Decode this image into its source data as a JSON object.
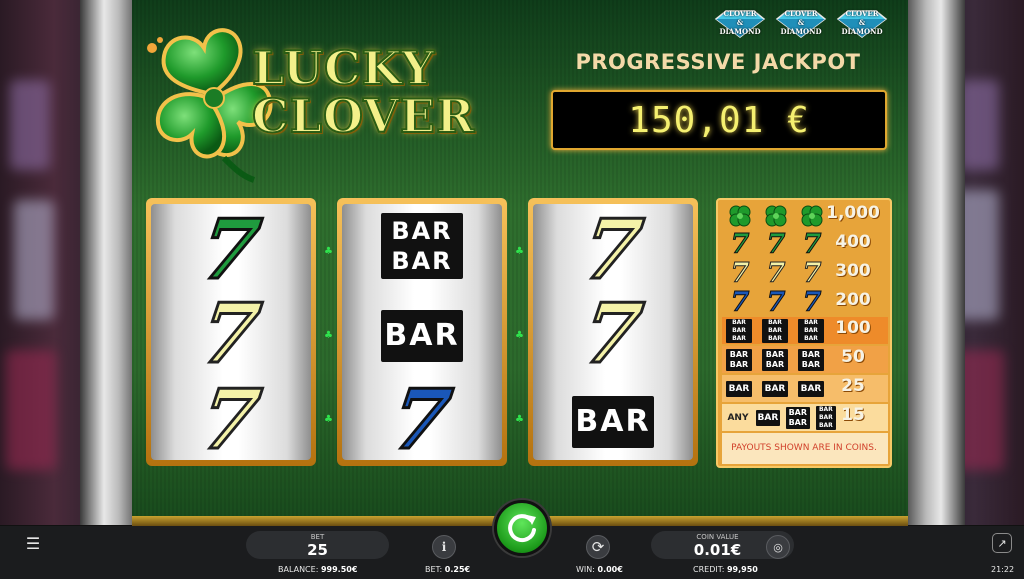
{
  "game": {
    "logo_line1": "LUCKY",
    "logo_line2": "CLOVER",
    "badges": [
      {
        "line1": "CLOVER",
        "line2": "&",
        "line3": "DIAMOND"
      },
      {
        "line1": "CLOVER",
        "line2": "&",
        "line3": "DIAMOND"
      },
      {
        "line1": "CLOVER",
        "line2": "&",
        "line3": "DIAMOND"
      }
    ]
  },
  "jackpot": {
    "title": "PROGRESSIVE JACKPOT",
    "value": "150,01 €"
  },
  "reels": [
    [
      "green-seven",
      "cream-seven",
      "cream-seven"
    ],
    [
      "double-bar",
      "single-bar",
      "blue-seven"
    ],
    [
      "cream-seven",
      "cream-seven",
      "single-bar"
    ]
  ],
  "symbols": {
    "seven": "7",
    "bar": "BAR",
    "any": "ANY"
  },
  "paytable": {
    "rows": [
      {
        "combo": "clover x3",
        "payout": "1,000"
      },
      {
        "combo": "green-seven x3",
        "payout": "400"
      },
      {
        "combo": "cream-seven x3",
        "payout": "300"
      },
      {
        "combo": "blue-seven x3",
        "payout": "200"
      },
      {
        "combo": "triple-bar x3",
        "payout": "100"
      },
      {
        "combo": "double-bar x3",
        "payout": "50"
      },
      {
        "combo": "single-bar x3",
        "payout": "25"
      },
      {
        "combo": "any bar x3",
        "payout": "15"
      }
    ],
    "note": "PAYOUTS SHOWN ARE IN COINS."
  },
  "colors": {
    "green_seven": "#1f9b3e",
    "cream_seven": "#f4f2a8",
    "blue_seven": "#1a57b8",
    "paytable_bg": "#e7a43a",
    "jackpot_digits": "#f5f070"
  },
  "controls": {
    "bet_label": "BET",
    "bet_value": "25",
    "coin_value_label": "COIN VALUE",
    "coin_value": "0.01€",
    "menu_icon": "menu-icon",
    "info_icon": "info-icon",
    "spin_icon": "spin-arrow-icon",
    "autoplay_icon": "autoplay-icon",
    "coins_icon": "coins-icon",
    "fullscreen_icon": "external-icon"
  },
  "status": {
    "balance_label": "BALANCE:",
    "balance_value": "999.50€",
    "bet_label": "BET:",
    "bet_value": "0.25€",
    "win_label": "WIN:",
    "win_value": "0.00€",
    "credit_label": "CREDIT:",
    "credit_value": "99,950",
    "clock": "21:22"
  }
}
